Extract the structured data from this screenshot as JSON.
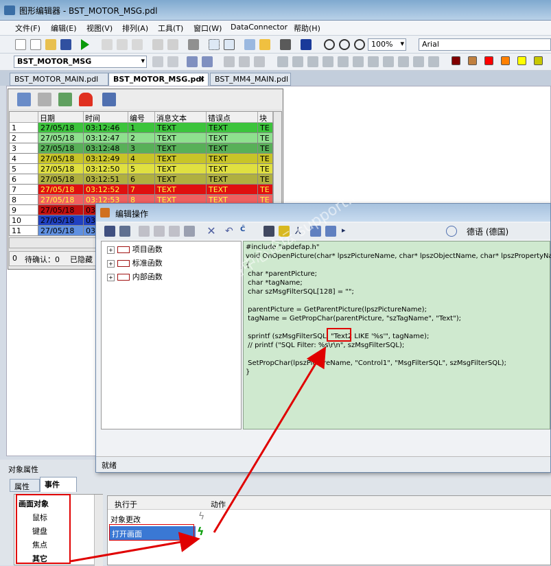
{
  "app": {
    "title": "图形编辑器 - BST_MOTOR_MSG.pdl"
  },
  "menu": [
    "文件(F)",
    "编辑(E)",
    "视图(V)",
    "排列(A)",
    "工具(T)",
    "窗口(W)",
    "DataConnector",
    "帮助(H)"
  ],
  "toolbar": {
    "zoom": "100%",
    "font": "Arial",
    "object_combo": "BST_MOTOR_MSG"
  },
  "tabs": [
    "BST_MOTOR_MAIN.pdl",
    "BST_MOTOR_MSG.pdl",
    "BST_MM4_MAIN.pdl"
  ],
  "table": {
    "headers": [
      "日期",
      "时间",
      "编号",
      "消息文本",
      "错误点",
      "块"
    ],
    "rows": [
      {
        "n": "1",
        "d": "27/05/18",
        "t": "03:12:46",
        "no": "1",
        "msg": "TEXT",
        "err": "TEXT",
        "blk": "TE",
        "bg": "#3cc43c"
      },
      {
        "n": "2",
        "d": "27/05/18",
        "t": "03:12:47",
        "no": "2",
        "msg": "TEXT",
        "err": "TEXT",
        "blk": "TE",
        "bg": "#8ee08e"
      },
      {
        "n": "3",
        "d": "27/05/18",
        "t": "03:12:48",
        "no": "3",
        "msg": "TEXT",
        "err": "TEXT",
        "blk": "TE",
        "bg": "#58b058"
      },
      {
        "n": "4",
        "d": "27/05/18",
        "t": "03:12:49",
        "no": "4",
        "msg": "TEXT",
        "err": "TEXT",
        "blk": "TE",
        "bg": "#c8c428"
      },
      {
        "n": "5",
        "d": "27/05/18",
        "t": "03:12:50",
        "no": "5",
        "msg": "TEXT",
        "err": "TEXT",
        "blk": "TE",
        "bg": "#e0e040"
      },
      {
        "n": "6",
        "d": "27/05/18",
        "t": "03:12:51",
        "no": "6",
        "msg": "TEXT",
        "err": "TEXT",
        "blk": "TE",
        "bg": "#b0b040"
      },
      {
        "n": "7",
        "d": "27/05/18",
        "t": "03:12:52",
        "no": "7",
        "msg": "TEXT",
        "err": "TEXT",
        "blk": "TE",
        "bg": "#e01010"
      },
      {
        "n": "8",
        "d": "27/05/18",
        "t": "03:12:53",
        "no": "8",
        "msg": "TEXT",
        "err": "TEXT",
        "blk": "TE",
        "bg": "#f06060"
      },
      {
        "n": "9",
        "d": "27/05/18",
        "t": "03",
        "no": "",
        "msg": "",
        "err": "",
        "blk": "",
        "bg": "#c01010"
      },
      {
        "n": "10",
        "d": "27/05/18",
        "t": "03",
        "no": "",
        "msg": "",
        "err": "",
        "blk": "",
        "bg": "#2040c0"
      },
      {
        "n": "11",
        "d": "27/05/18",
        "t": "03",
        "no": "",
        "msg": "",
        "err": "",
        "blk": "",
        "bg": "#6090e0"
      }
    ]
  },
  "status_bar": {
    "count": "0",
    "pending": "待确认：0",
    "hidden": "已隐藏"
  },
  "dialog": {
    "title": "编辑操作",
    "language": "德语 (德国)",
    "status": "就绪",
    "tree": [
      "项目函数",
      "标准函数",
      "内部函数"
    ],
    "code": "#include \"apdefap.h\"\nvoid OnOpenPicture(char* lpszPictureName, char* lpszObjectName, char* lpszPropertyName)\n{\n char *parentPicture;\n char *tagName;\n char szMsgFilterSQL[128] = \"\";\n\n parentPicture = GetParentPicture(lpszPictureName);\n tagName = GetPropChar(parentPicture, \"szTagName\", \"Text\");\n\n sprintf (szMsgFilterSQL, \"Text2 LIKE '%s'\", tagName);\n // printf (\"SQL Filter: %s\\r\\n\", szMsgFilterSQL);\n\n SetPropChar(lpszPictureName, \"Control1\", \"MsgFilterSQL\", szMsgFilterSQL);\n}"
  },
  "props": {
    "panel_title": "对象属性",
    "tabs": [
      "属性",
      "事件"
    ],
    "tree": [
      "画面对象",
      "鼠标",
      "键盘",
      "焦点",
      "其它"
    ],
    "headers": [
      "执行于",
      "动作"
    ],
    "events": [
      "对象更改",
      "打开画面"
    ]
  },
  "watermark": "西门子工业支持中心论坛 support.industry.siemens.com/cs",
  "colors": [
    "#800000",
    "#c08040",
    "#ff0000",
    "#ff8000",
    "#ffff00",
    "#c8c800",
    "#00a000"
  ]
}
